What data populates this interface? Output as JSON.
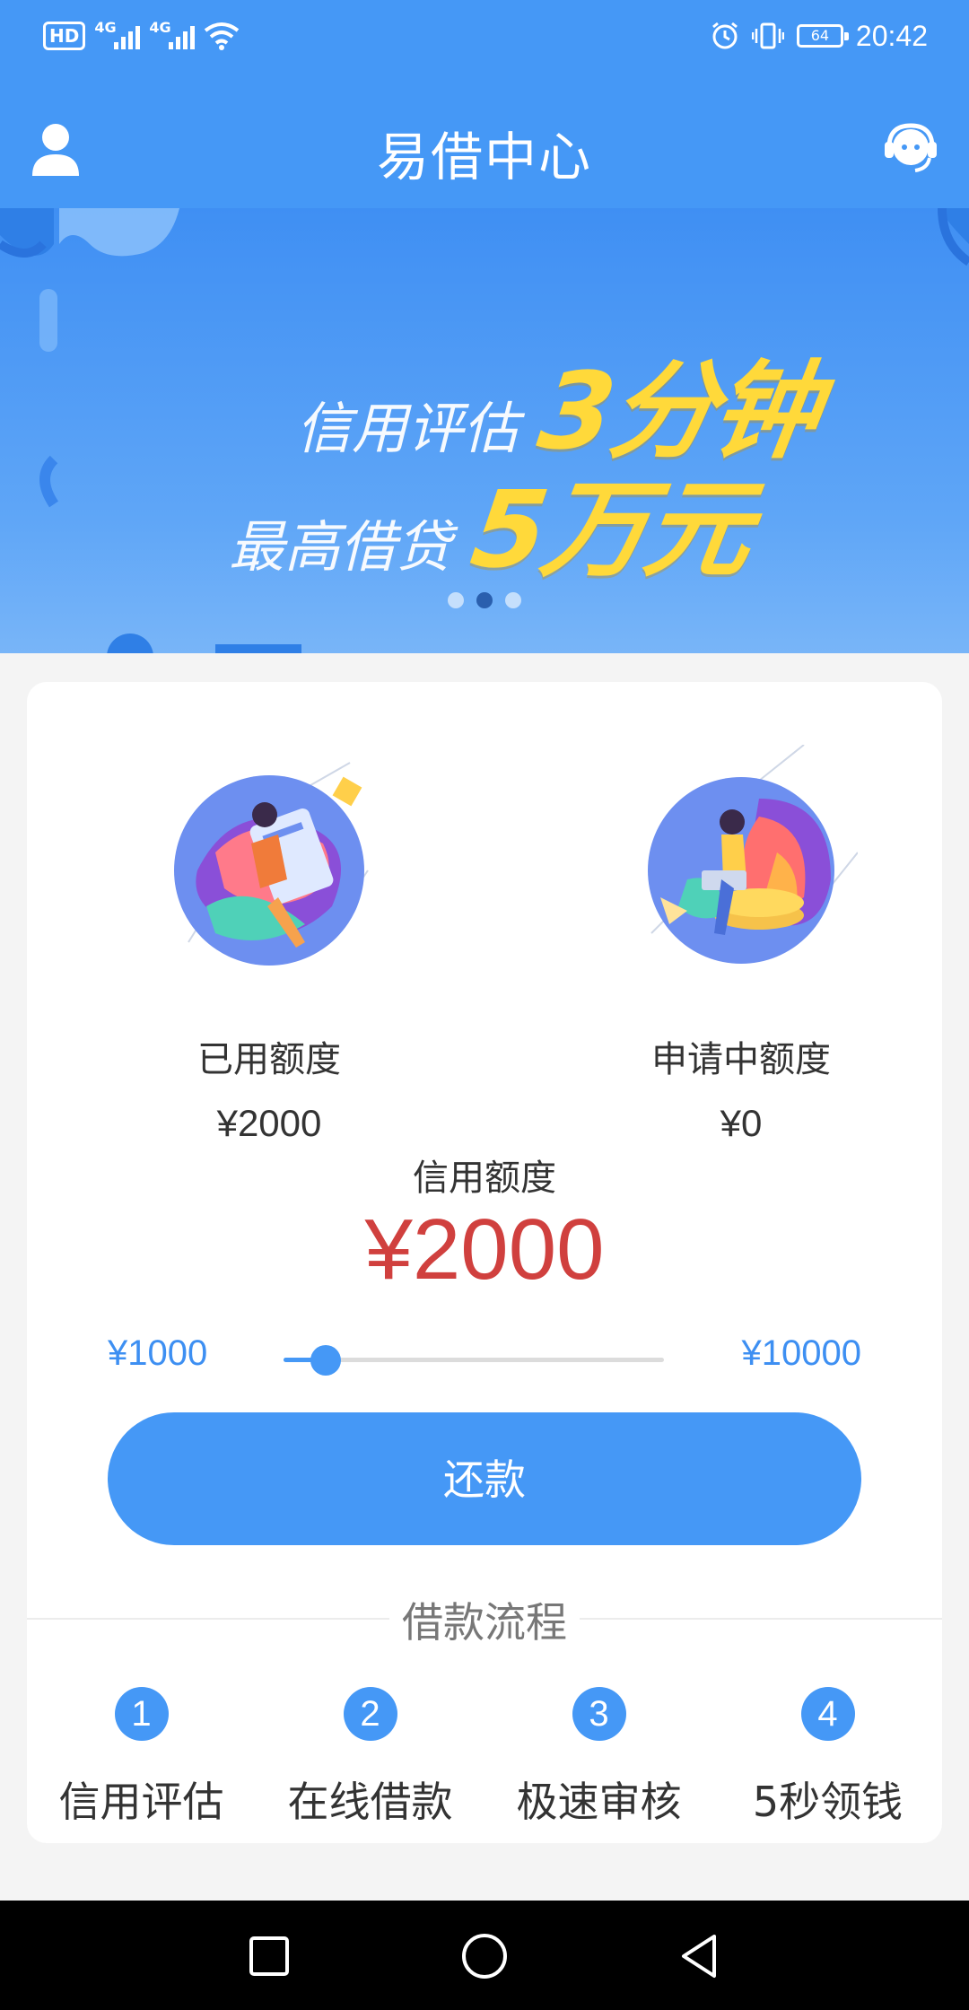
{
  "status_bar": {
    "hd": "HD",
    "net1": "4G",
    "net2": "4G",
    "battery": "64",
    "time": "20:42"
  },
  "header": {
    "title": "易借中心",
    "left_icon": "user-icon",
    "right_icon": "customer-service-icon"
  },
  "banner": {
    "line1_small": "信用评估",
    "line1_big": "3分钟",
    "line2_small": "最高借贷",
    "line2_big": "5万元",
    "slide_count": 3,
    "active_slide": 2
  },
  "quota": {
    "used_label": "已用额度",
    "used_value": "¥2000",
    "applying_label": "申请中额度",
    "applying_value": "¥0"
  },
  "credit": {
    "label": "信用额度",
    "value": "¥2000"
  },
  "slider": {
    "min_label": "¥1000",
    "max_label": "¥10000",
    "fraction": 0.11
  },
  "repay_button": "还款",
  "flow": {
    "title": "借款流程",
    "steps": [
      {
        "num": "1",
        "label": "信用评估"
      },
      {
        "num": "2",
        "label": "在线借款"
      },
      {
        "num": "3",
        "label": "极速审核"
      },
      {
        "num": "4",
        "label": "5秒领钱"
      }
    ]
  },
  "colors": {
    "primary": "#4598f6",
    "amount_red": "#d0403e",
    "banner_yellow": "#ffd93a"
  }
}
